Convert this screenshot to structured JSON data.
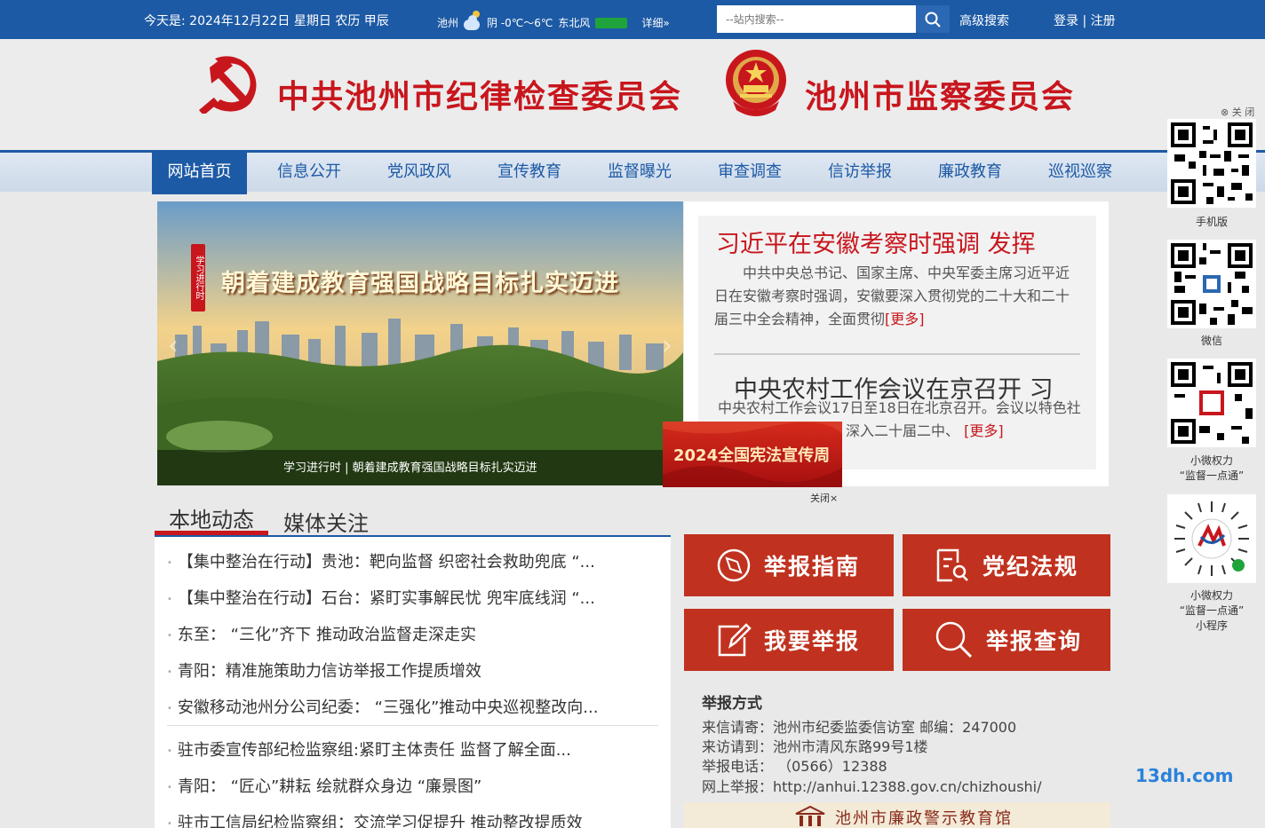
{
  "topbar": {
    "date": "今天是:  2024年12月22日 星期日 农历 甲辰",
    "city": "池州",
    "weather": "阴 -0℃～6℃",
    "wind": "东北风",
    "detail": "详细»",
    "search_placeholder": "--站内搜索--",
    "advanced_search": "高级搜索",
    "login": "登录 | 注册",
    "aqi_color": "#1fa43b"
  },
  "header": {
    "title_left": "中共池州市纪律检查委员会",
    "title_right": "池州市监察委员会"
  },
  "nav": {
    "items": [
      "网站首页",
      "信息公开",
      "党风政风",
      "宣传教育",
      "监督曝光",
      "审查调查",
      "信访举报",
      "廉政教育",
      "巡视巡察"
    ]
  },
  "slider": {
    "tag": "学习进行时",
    "heading": "朝着建成教育强国战略目标扎实迈进",
    "caption": "学习进行时 | 朝着建成教育强国战略目标扎实迈进",
    "prev": "‹",
    "next": "›"
  },
  "headlines": {
    "item1_title": "习近平在安徽考察时强调 发挥",
    "item1_text": "中共中央总书记、国家主席、中央军委主席习近平近日在安徽考察时强调，安徽要深入贯彻党的二十大和二十届三中全会精神，全面贯彻",
    "item2_title": "中央农村工作会议在京召开 习",
    "item2_text": "中央农村工作会议17日至18日在北京召开。会议以特色社会主义思想为指导，深入二十届二中、",
    "more": "[更多]"
  },
  "constitution_week": {
    "text": "2024全国宪法宣传周",
    "close": "关闭×"
  },
  "tabs": {
    "local": "本地动态",
    "media": "媒体关注"
  },
  "news": [
    "【集中整治在行动】贵池：靶向监督 织密社会救助兜底 “...",
    "【集中整治在行动】石台：紧盯实事解民忧 兜牢底线润 “...",
    "东至： “三化”齐下 推动政治监督走深走实",
    "青阳：精准施策助力信访举报工作提质增效",
    "安徽移动池州分公司纪委： “三强化”推动中央巡视整改向...",
    "驻市委宣传部纪检监察组:紧盯主体责任 监督了解全面...",
    "青阳： “匠心”耕耘 绘就群众身边 “廉景图”",
    "驻市工信局纪检监察组：交流学习促提升 推动整改提质效"
  ],
  "actions": {
    "guide": "举报指南",
    "regulations": "党纪法规",
    "report": "我要举报",
    "query": "举报查询",
    "color": "#c0321f"
  },
  "report_methods": {
    "title": "举报方式",
    "letter": "来信请寄：池州市纪委监委信访室 邮编：247000",
    "visit": "来访请到：池州市清风东路99号1楼",
    "phone": "举报电话： （0566）12388",
    "online": "网上举报：http://anhui.12388.gov.cn/chizhoushi/"
  },
  "museum": {
    "text": "池州市廉政警示教育馆"
  },
  "qr_sidebar": {
    "close": "⊗ 关 闭",
    "mobile": "手机版",
    "wechat": "微信",
    "micro_power_1": "小微权力",
    "micro_power_2": "“监督一点通”",
    "mini_1": "小微权力",
    "mini_2": "“监督一点通”",
    "mini_3": "小程序"
  },
  "watermark": "13dh.com",
  "colors": {
    "brand_blue": "#1d5aa5",
    "brand_red": "#c8161d"
  }
}
